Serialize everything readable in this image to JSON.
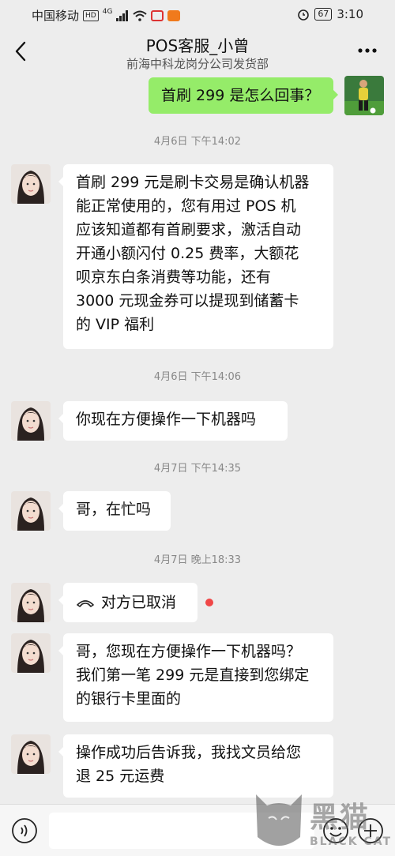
{
  "status_bar": {
    "carrier": "中国移动",
    "hd_badge": "HD",
    "network": "4G",
    "battery": "67",
    "time": "3:10"
  },
  "header": {
    "title": "POS客服_小曾",
    "subtitle": "前海中科龙岗分公司发货部"
  },
  "messages": {
    "m1": {
      "text": "首刷 299 是怎么回事？"
    },
    "t1": "4月6日 下午14:02",
    "m2": {
      "lines": [
        "首刷 299 元是刷卡交易是确认机器",
        "能正常使用的，您有用过 POS 机",
        "应该知道都有首刷要求，激活自动",
        "开通小额闪付 0.25 费率，大额花",
        "呗京东白条消费等功能，还有",
        "3000 元现金券可以提现到储蓄卡",
        "的 VIP 福利"
      ]
    },
    "t2": "4月6日 下午14:06",
    "m3": {
      "text": "你现在方便操作一下机器吗"
    },
    "t3": "4月7日 下午14:35",
    "m4": {
      "text": "哥，在忙吗"
    },
    "t4": "4月7日 晚上18:33",
    "m5": {
      "text": "对方已取消",
      "icon": "phone-hangup-icon"
    },
    "m6": {
      "lines": [
        "哥，您现在方便操作一下机器吗？",
        "我们第一笔 299 元是直接到您绑定",
        "的银行卡里面的"
      ]
    },
    "m7": {
      "lines": [
        "操作成功后告诉我，我找文员给您",
        "退 25 元运费"
      ]
    }
  },
  "watermark": {
    "text": "黑猫",
    "sub": "BLACK CAT"
  },
  "colors": {
    "background": "#ededed",
    "my_bubble": "#95ec69",
    "their_bubble": "#ffffff",
    "unread_dot": "#f04747"
  }
}
